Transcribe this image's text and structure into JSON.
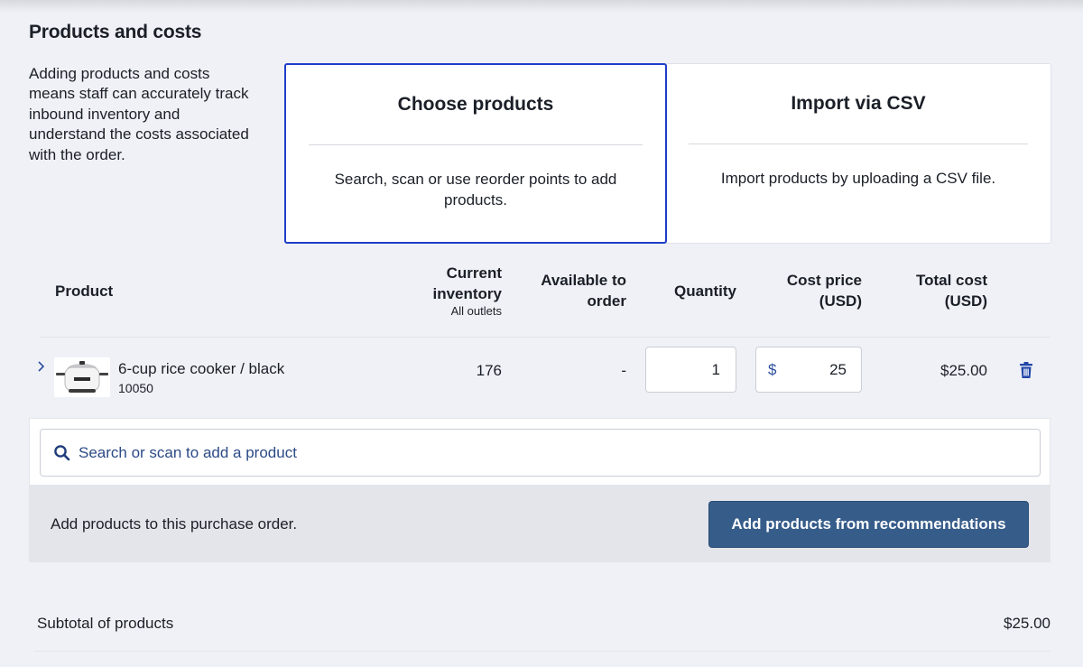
{
  "section": {
    "title": "Products and costs",
    "description": "Adding products and costs means staff can accurately track inbound inventory and understand the costs associated with the order."
  },
  "options": [
    {
      "title": "Choose products",
      "text": "Search, scan or use reorder points to add products.",
      "selected": true
    },
    {
      "title": "Import via CSV",
      "text": "Import products by uploading a CSV file.",
      "selected": false
    }
  ],
  "table": {
    "headers": {
      "product": "Product",
      "inventory": "Current inventory",
      "inventory_sub": "All outlets",
      "available": "Available to order",
      "quantity": "Quantity",
      "cost": "Cost price (USD)",
      "total": "Total cost (USD)"
    },
    "rows": [
      {
        "name": "6-cup rice cooker / black",
        "sku": "10050",
        "inventory": "176",
        "available": "-",
        "quantity": "1",
        "currency_symbol": "$",
        "cost": "25",
        "total": "$25.00"
      }
    ]
  },
  "search": {
    "placeholder": "Search or scan to add a product"
  },
  "footer": {
    "text": "Add products to this purchase order.",
    "button_label": "Add products from recommendations"
  },
  "summary": {
    "subtotal_label": "Subtotal of products",
    "subtotal_value": "$25.00"
  },
  "colors": {
    "accent": "#1f3ec9",
    "primary_button": "#365c8a",
    "link_icon": "#2d4e9e"
  },
  "icons": {
    "expand": "chevron-right-icon",
    "search": "search-icon",
    "delete": "trash-icon"
  }
}
